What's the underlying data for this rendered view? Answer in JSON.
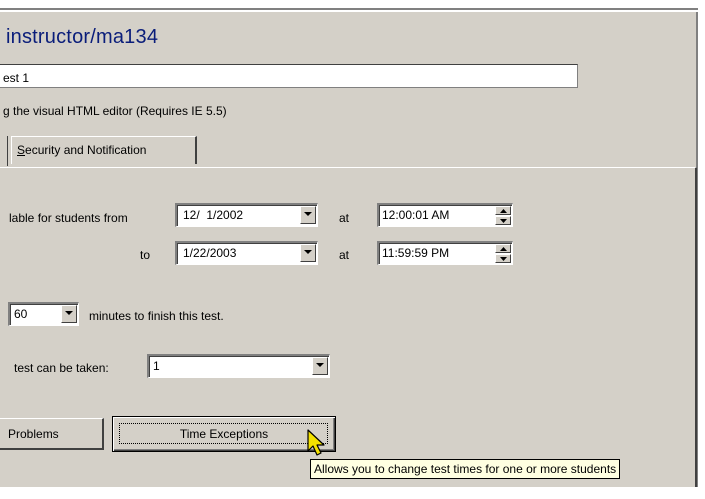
{
  "title": "instructor/ma134",
  "test_name": {
    "value": "est 1"
  },
  "editor_note": "g the visual HTML editor (Requires IE 5.5)",
  "tabs": [
    {
      "label": "Security and Notification",
      "access_key": "S",
      "rest": "ecurity and Notification"
    }
  ],
  "availability": {
    "from_label": "lable for students from",
    "from_date": "12/  1/2002",
    "at_label_1": "at",
    "from_time": "12:00:01 AM",
    "to_label": "to",
    "to_date": "1/22/2003",
    "at_label_2": "at",
    "to_time": "11:59:59 PM"
  },
  "duration": {
    "minutes": "60",
    "label": "minutes to finish this test."
  },
  "attempts": {
    "label": "test can be taken:",
    "value": "1"
  },
  "buttons": {
    "problems": "Problems",
    "time_exceptions": "Time Exceptions"
  },
  "tooltip": "Allows you to change test times for one or more students",
  "colors": {
    "title": "#0a1d7a",
    "panel": "#d4d0c8",
    "tooltip_bg": "#ffffe1"
  }
}
